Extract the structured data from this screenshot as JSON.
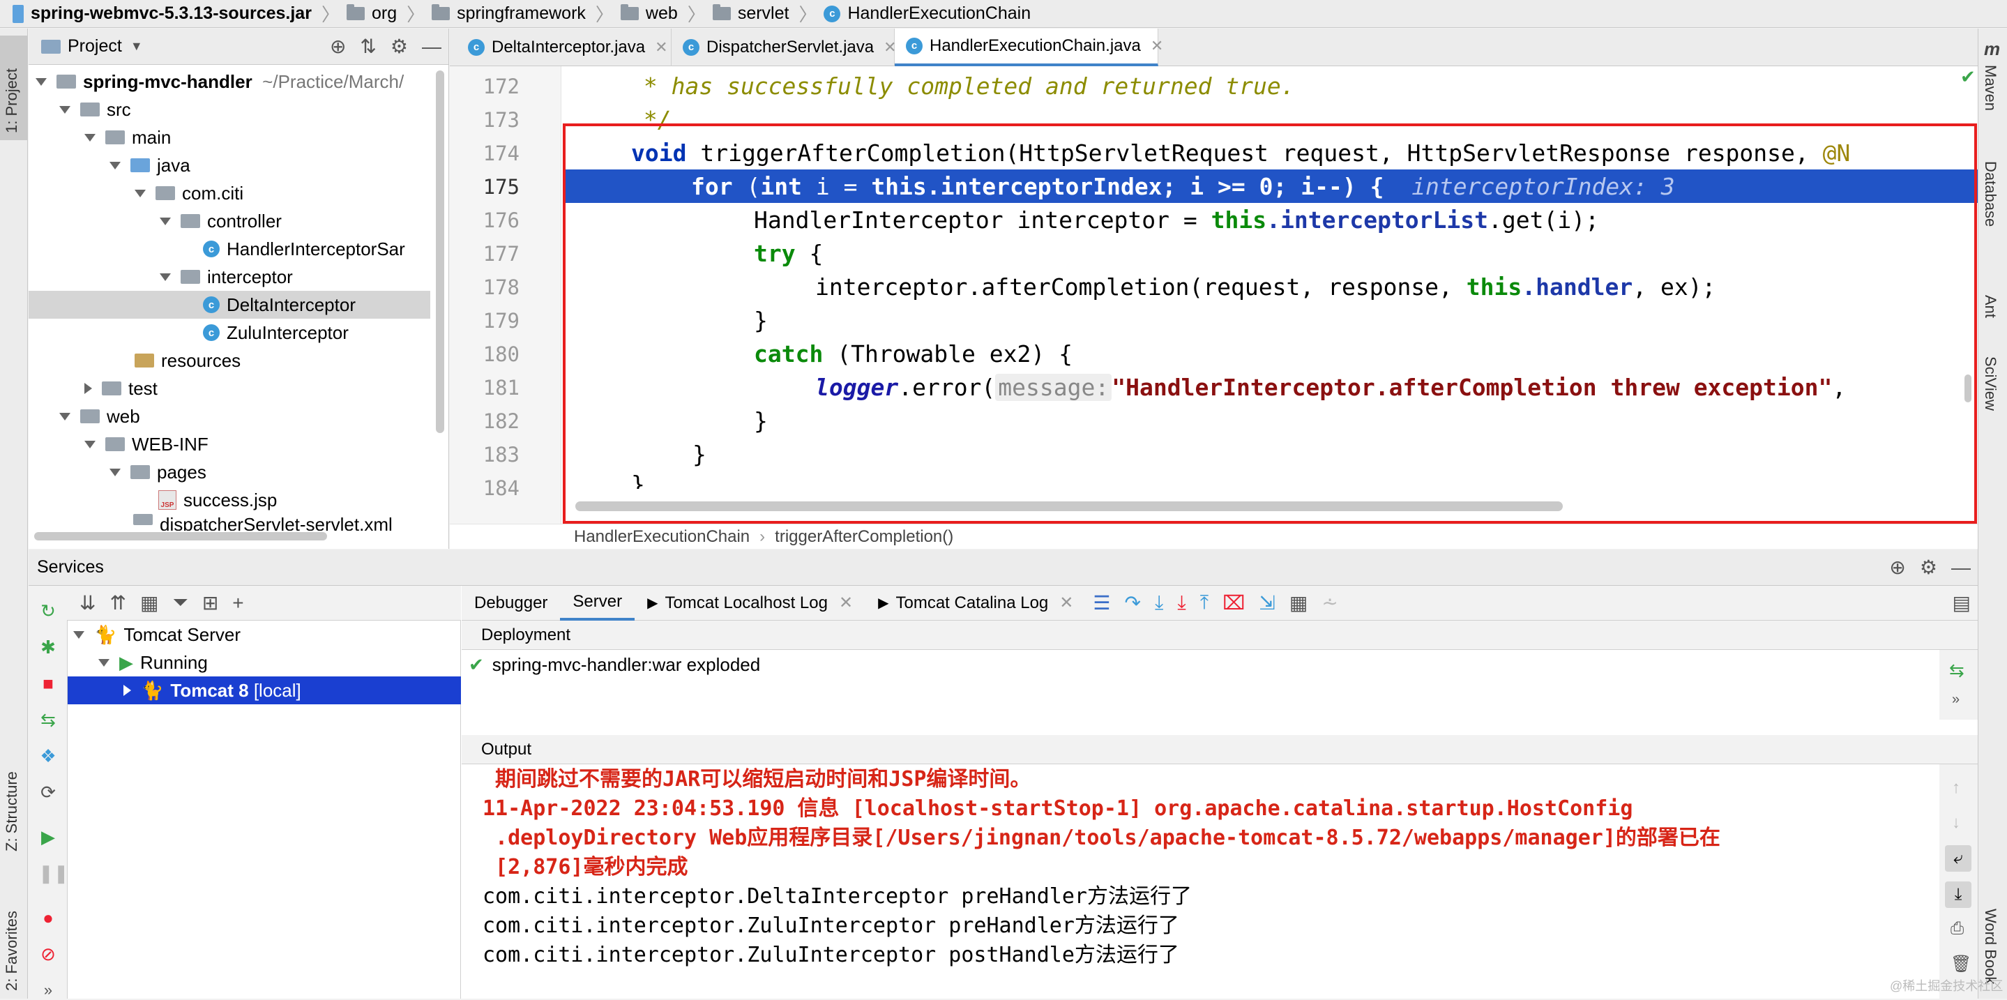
{
  "breadcrumb": [
    "spring-webmvc-5.3.13-sources.jar",
    "org",
    "springframework",
    "web",
    "servlet",
    "HandlerExecutionChain"
  ],
  "left_stripe": {
    "project": "1: Project",
    "structure": "Z: Structure",
    "favorites": "2: Favorites"
  },
  "right_stripe": {
    "maven": "Maven",
    "database": "Database",
    "ant": "Ant",
    "sciview": "SciView",
    "wordbook": "Word Book"
  },
  "project": {
    "title": "Project",
    "tree": [
      {
        "label": "spring-mvc-handler",
        "extra": "~/Practice/March/"
      },
      {
        "label": "src"
      },
      {
        "label": "main"
      },
      {
        "label": "java"
      },
      {
        "label": "com.citi"
      },
      {
        "label": "controller"
      },
      {
        "label": "HandlerInterceptorSar"
      },
      {
        "label": "interceptor"
      },
      {
        "label": "DeltaInterceptor"
      },
      {
        "label": "ZuluInterceptor"
      },
      {
        "label": "resources"
      },
      {
        "label": "test"
      },
      {
        "label": "web"
      },
      {
        "label": "WEB-INF"
      },
      {
        "label": "pages"
      },
      {
        "label": "success.jsp"
      },
      {
        "label": "dispatcherServlet-servlet.xml"
      }
    ]
  },
  "editor": {
    "tabs": [
      "DeltaInterceptor.java",
      "DispatcherServlet.java",
      "HandlerExecutionChain.java"
    ],
    "lines": [
      "172",
      "173",
      "174",
      "175",
      "176",
      "177",
      "178",
      "179",
      "180",
      "181",
      "182",
      "183",
      "184"
    ],
    "code": {
      "l172": " * has successfully completed and returned true.",
      "l173": " */",
      "l174_kw": "void",
      "l174_rest": " triggerAfterCompletion(HttpServletRequest request, HttpServletResponse response, ",
      "l174_ann": "@N",
      "l175_a": "for",
      "l175_b": " (",
      "l175_c": "int",
      "l175_d": " i = ",
      "l175_e": "this",
      "l175_f": ".interceptorIndex; i >= 0; i--) {",
      "l175_hint": "interceptorIndex: 3",
      "l176_a": "HandlerInterceptor interceptor = ",
      "l176_b": "this",
      "l176_c": ".interceptorList",
      "l176_d": ".get(i);",
      "l177": "try",
      "l177_b": " {",
      "l178_a": "interceptor.afterCompletion(request, response, ",
      "l178_b": "this",
      "l178_c": ".handler",
      "l178_d": ", ex);",
      "l179": "}",
      "l180_a": "catch",
      "l180_b": " (Throwable ex2) {",
      "l181_a": "logger",
      "l181_b": ".error(",
      "l181_hint": "message:",
      "l181_str": "\"HandlerInterceptor.afterCompletion threw exception\"",
      "l181_end": ",",
      "l182": "}",
      "l183": "}",
      "l184": "}"
    },
    "crumb": [
      "HandlerExecutionChain",
      "triggerAfterCompletion()"
    ]
  },
  "services": {
    "title": "Services",
    "tree": [
      {
        "label": "Tomcat Server"
      },
      {
        "label": "Running"
      },
      {
        "label": "Tomcat 8",
        "extra": "[local]"
      }
    ],
    "tabs": [
      "Debugger",
      "Server",
      "Tomcat Localhost Log",
      "Tomcat Catalina Log"
    ],
    "deployment_label": "Deployment",
    "deployment_item": "spring-mvc-handler:war exploded",
    "output_label": "Output",
    "output": [
      {
        "text": " 期间跳过不需要的JAR可以缩短启动时间和JSP编译时间。",
        "err": true
      },
      {
        "text": "11-Apr-2022 23:04:53.190 信息 [localhost-startStop-1] org.apache.catalina.startup.HostConfig",
        "err": true
      },
      {
        "text": " .deployDirectory Web应用程序目录[/Users/jingnan/tools/apache-tomcat-8.5.72/webapps/manager]的部署已在",
        "err": true
      },
      {
        "text": " [2,876]毫秒内完成",
        "err": true
      },
      {
        "text": "com.citi.interceptor.DeltaInterceptor preHandler方法运行了",
        "err": false
      },
      {
        "text": "com.citi.interceptor.ZuluInterceptor preHandler方法运行了",
        "err": false
      },
      {
        "text": "com.citi.interceptor.ZuluInterceptor postHandle方法运行了",
        "err": false
      }
    ],
    "watermark": "@稀土掘金技术社区"
  }
}
